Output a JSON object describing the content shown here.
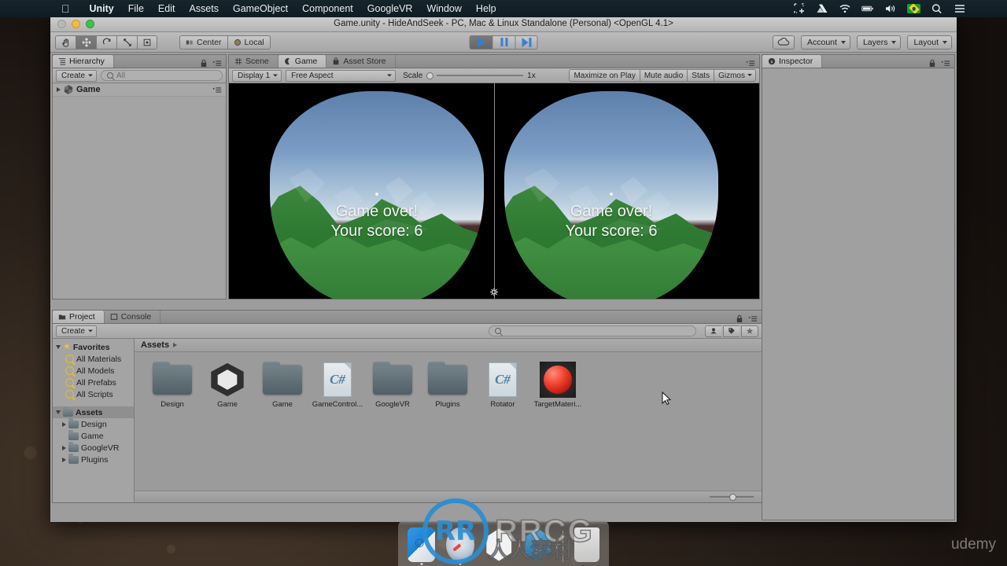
{
  "menubar": {
    "apple": "",
    "items": [
      {
        "label": "Unity",
        "bold": true
      },
      {
        "label": "File",
        "bold": false
      },
      {
        "label": "Edit",
        "bold": false
      },
      {
        "label": "Assets",
        "bold": false
      },
      {
        "label": "GameObject",
        "bold": false
      },
      {
        "label": "Component",
        "bold": false
      },
      {
        "label": "GoogleVR",
        "bold": false
      },
      {
        "label": "Window",
        "bold": false
      },
      {
        "label": "Help",
        "bold": false
      }
    ],
    "status_icons": [
      "screenshot-crop-icon",
      "google-drive-icon",
      "wifi-icon",
      "battery-icon",
      "volume-icon",
      "brazil-flag-icon",
      "search-icon",
      "notification-list-icon"
    ]
  },
  "window": {
    "title": "Game.unity - HideAndSeek - PC, Mac & Linux Standalone (Personal) <OpenGL 4.1>"
  },
  "toolbar": {
    "tools": [
      {
        "name": "hand-tool",
        "glyph": "✋",
        "active": false
      },
      {
        "name": "move-tool",
        "glyph": "✥",
        "active": true
      },
      {
        "name": "rotate-tool",
        "glyph": "⟳",
        "active": false
      },
      {
        "name": "scale-tool",
        "glyph": "⤢",
        "active": false
      },
      {
        "name": "rect-tool",
        "glyph": "⬚",
        "active": false
      }
    ],
    "pivot_mode": "Center",
    "pivot_rotation": "Local",
    "playback": {
      "play": "play-button",
      "pause": "pause-button",
      "step": "step-button",
      "playing": true
    },
    "cloud": "unity-cloud-button",
    "account": "Account",
    "layers": "Layers",
    "layout": "Layout"
  },
  "hierarchy": {
    "tab": "Hierarchy",
    "create_label": "Create",
    "search_placeholder": "All",
    "items": [
      {
        "label": "Game"
      }
    ]
  },
  "gameview": {
    "tabs": [
      {
        "label": "Scene",
        "active": false
      },
      {
        "label": "Game",
        "active": true
      },
      {
        "label": "Asset Store",
        "active": false
      }
    ],
    "display": "Display 1",
    "aspect": "Free Aspect",
    "scale_label": "Scale",
    "scale_value": "1x",
    "maximize_on_play": "Maximize on Play",
    "mute_audio": "Mute audio",
    "stats": "Stats",
    "gizmos": "Gizmos",
    "overlay_line1": "Game over!",
    "overlay_line2": "Your score: 6"
  },
  "project": {
    "tabs": [
      {
        "label": "Project",
        "active": true
      },
      {
        "label": "Console",
        "active": false
      }
    ],
    "create_label": "Create",
    "search_placeholder": "",
    "breadcrumb": "Assets",
    "tree": {
      "favorites_label": "Favorites",
      "favorites": [
        "All Materials",
        "All Models",
        "All Prefabs",
        "All Scripts"
      ],
      "assets_label": "Assets",
      "assets": [
        {
          "label": "Design",
          "expandable": true
        },
        {
          "label": "Game",
          "expandable": false
        },
        {
          "label": "GoogleVR",
          "expandable": true
        },
        {
          "label": "Plugins",
          "expandable": true
        }
      ]
    },
    "assets": [
      {
        "label": "Design",
        "type": "folder"
      },
      {
        "label": "Game",
        "type": "unity-scene"
      },
      {
        "label": "Game",
        "type": "folder"
      },
      {
        "label": "GameControl...",
        "type": "csharp"
      },
      {
        "label": "GoogleVR",
        "type": "folder"
      },
      {
        "label": "Plugins",
        "type": "folder"
      },
      {
        "label": "Rotator",
        "type": "csharp"
      },
      {
        "label": "TargetMateri...",
        "type": "material"
      }
    ]
  },
  "inspector": {
    "tab": "Inspector"
  },
  "dock": {
    "items": [
      "finder-icon",
      "safari-icon",
      "unity-icon",
      "unity-hub-icon",
      "trash-icon"
    ]
  },
  "watermarks": {
    "rrcg_mark": "RR",
    "rrcg": "RRCG",
    "chinese": "人人素材",
    "udemy": "udemy"
  },
  "colors": {
    "accent_blue": "#2f7fe0",
    "panel_gray": "#a0a0a0",
    "toolbar_gray": "#b4b4b4",
    "menubar_dark": "#16242c"
  }
}
